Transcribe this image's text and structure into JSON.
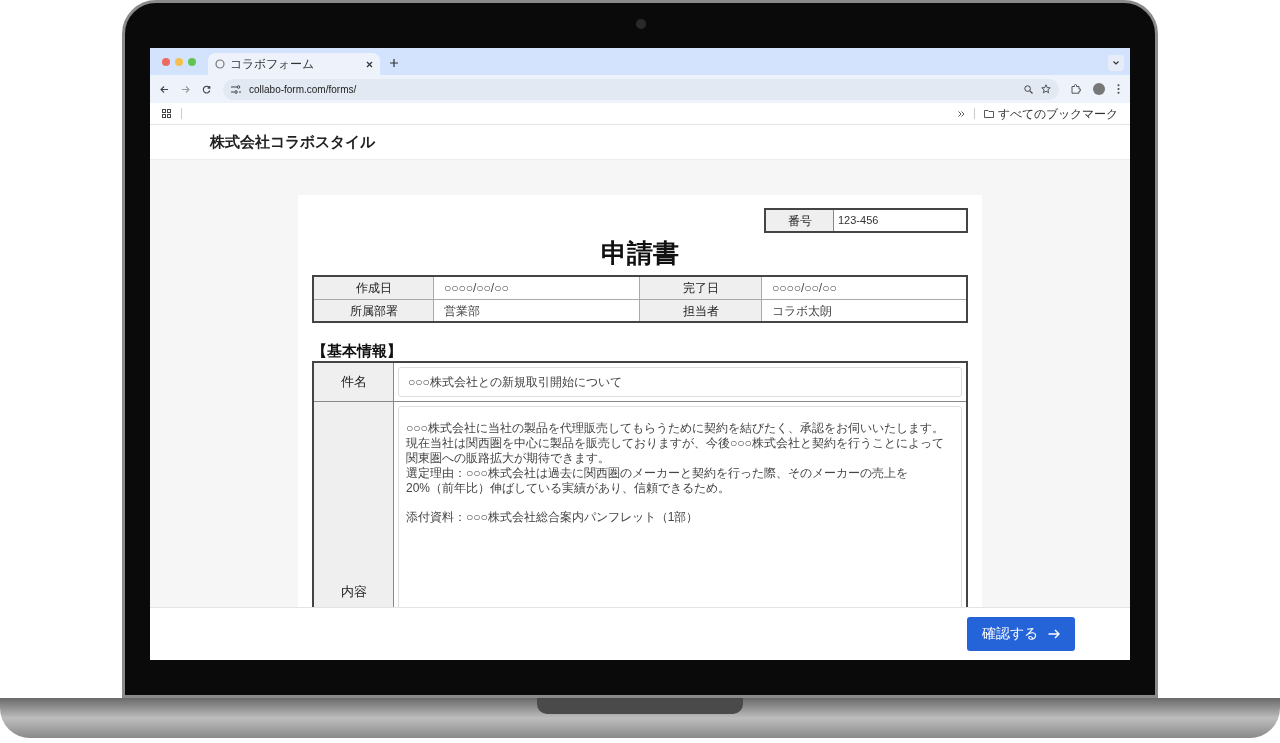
{
  "browser": {
    "tab_title": "コラボフォーム",
    "url": "collabo-form.com/forms/",
    "bookmarks_label": "すべてのブックマーク"
  },
  "header": {
    "company": "株式会社コラボスタイル"
  },
  "form": {
    "number": {
      "label": "番号",
      "value": "123-456"
    },
    "title": "申請書",
    "info": [
      {
        "label": "作成日",
        "value": "○○○○/○○/○○"
      },
      {
        "label": "完了日",
        "value": "○○○○/○○/○○"
      },
      {
        "label": "所属部署",
        "value": "営業部"
      },
      {
        "label": "担当者",
        "value": "コラボ太朗"
      }
    ],
    "section_title": "【基本情報】",
    "fields": [
      {
        "kind": "line",
        "label": "件名",
        "value": "○○○株式会社との新規取引開始について"
      },
      {
        "kind": "area",
        "label": "内容",
        "paragraphs": [
          [
            "○○○株式会社に当社の製品を代理販売してもらうために契約を結びたく、承認をお伺いいたします。",
            "現在当社は関西圏を中心に製品を販売しておりますが、今後○○○株式会社と契約を行うことによって",
            "関東圏への販路拡大が期待できます。",
            "選定理由：○○○株式会社は過去に関西圏のメーカーと契約を行った際、そのメーカーの売上を",
            "20%（前年比）伸ばしている実績があり、信頼できるため。"
          ],
          [
            "添付資料：○○○株式会社総合案内パンフレット（1部）"
          ]
        ]
      }
    ]
  },
  "footer": {
    "button": "確認する"
  }
}
